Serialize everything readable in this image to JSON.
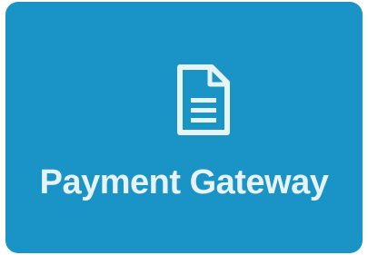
{
  "tile": {
    "label": "Payment Gateway",
    "icon": "document-icon",
    "background_color": "#1a93c6",
    "foreground_color": "#e6f3f9"
  }
}
